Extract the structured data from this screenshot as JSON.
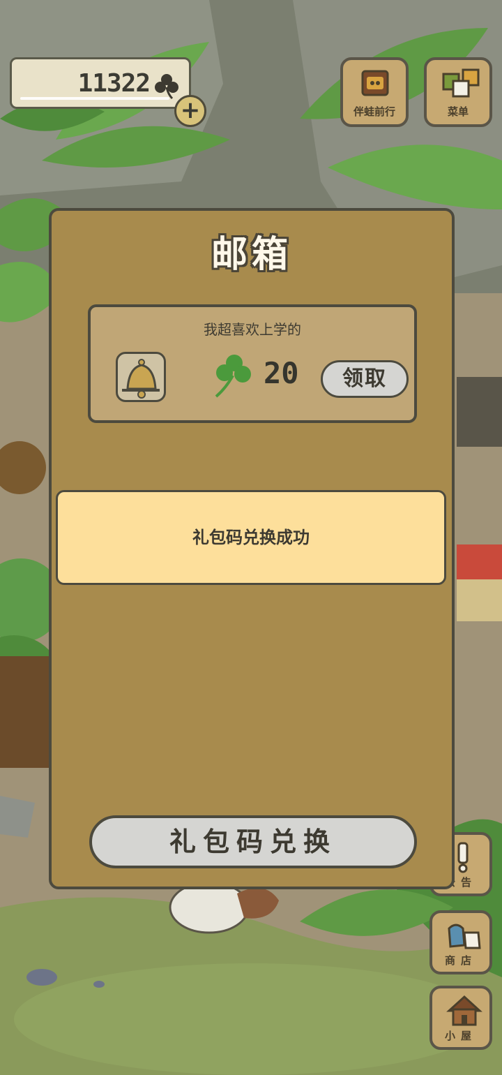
{
  "app": {
    "clover_count": "11322"
  },
  "top_buttons": {
    "travel_label": "伴蛙前行",
    "menu_label": "菜单"
  },
  "side_buttons": {
    "notice_label": "公告",
    "shop_label": "商店",
    "house_label": "小屋"
  },
  "mailbox": {
    "title": "邮箱",
    "mail": {
      "subject": "我超喜欢上学的",
      "reward_amount": "20",
      "claim_label": "领取"
    },
    "toast": "礼包码兑换成功",
    "redeem_label": "礼包码兑换"
  },
  "colors": {
    "panel": "#a88b4d",
    "card": "#c0a676",
    "toast": "#fddf9b",
    "button": "#d5d5d2",
    "border": "#4c4a3e",
    "clover_green": "#4b9a3c"
  },
  "icons": {
    "currency": "clover-icon",
    "reward_item": "bell-icon",
    "add": "plus-icon"
  }
}
